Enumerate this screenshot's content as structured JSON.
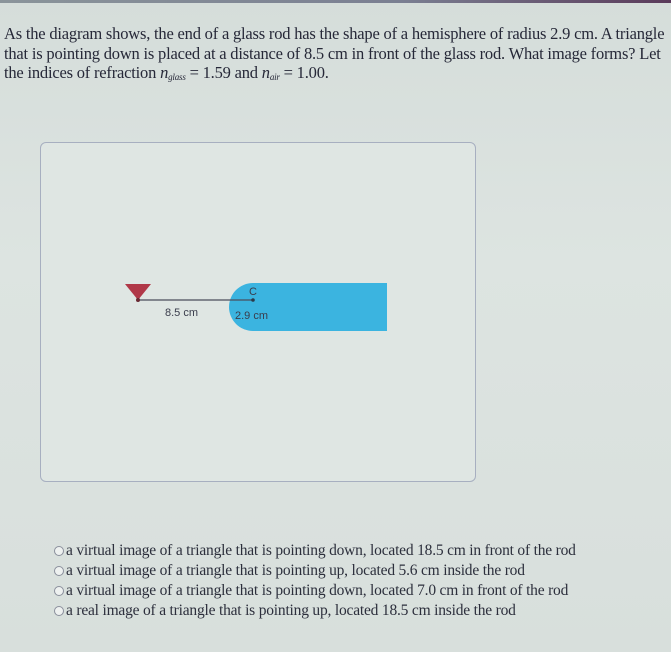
{
  "question": {
    "part1": "As the diagram shows, the end of a glass rod has the shape of a hemisphere of radius 2.9 cm. A triangle that is pointing down is placed at a distance of 8.5 cm in front of the glass rod. What image forms? Let the indices of refraction ",
    "n_symbol": "n",
    "n_glass_sub": "glass",
    "n_glass_value": " = 1.59",
    "and_text": " and ",
    "n_air_sub": "air",
    "n_air_value": " = 1.00."
  },
  "diagram": {
    "object_distance_label": "8.5 cm",
    "radius_label": "2.9 cm",
    "center_label": "C",
    "object_color": "#b03848",
    "rod_color": "#3bb4e0"
  },
  "options": [
    {
      "label": "a virtual image of a triangle that is pointing down, located 18.5 cm in front of the rod",
      "selected": false
    },
    {
      "label": "a virtual image of a triangle that is pointing up, located 5.6 cm inside the rod",
      "selected": false
    },
    {
      "label": "a virtual image of a triangle that is pointing down, located 7.0 cm in front of the rod",
      "selected": false
    },
    {
      "label": "a real image of a triangle that is pointing up, located 18.5 cm inside the rod",
      "selected": false
    }
  ]
}
